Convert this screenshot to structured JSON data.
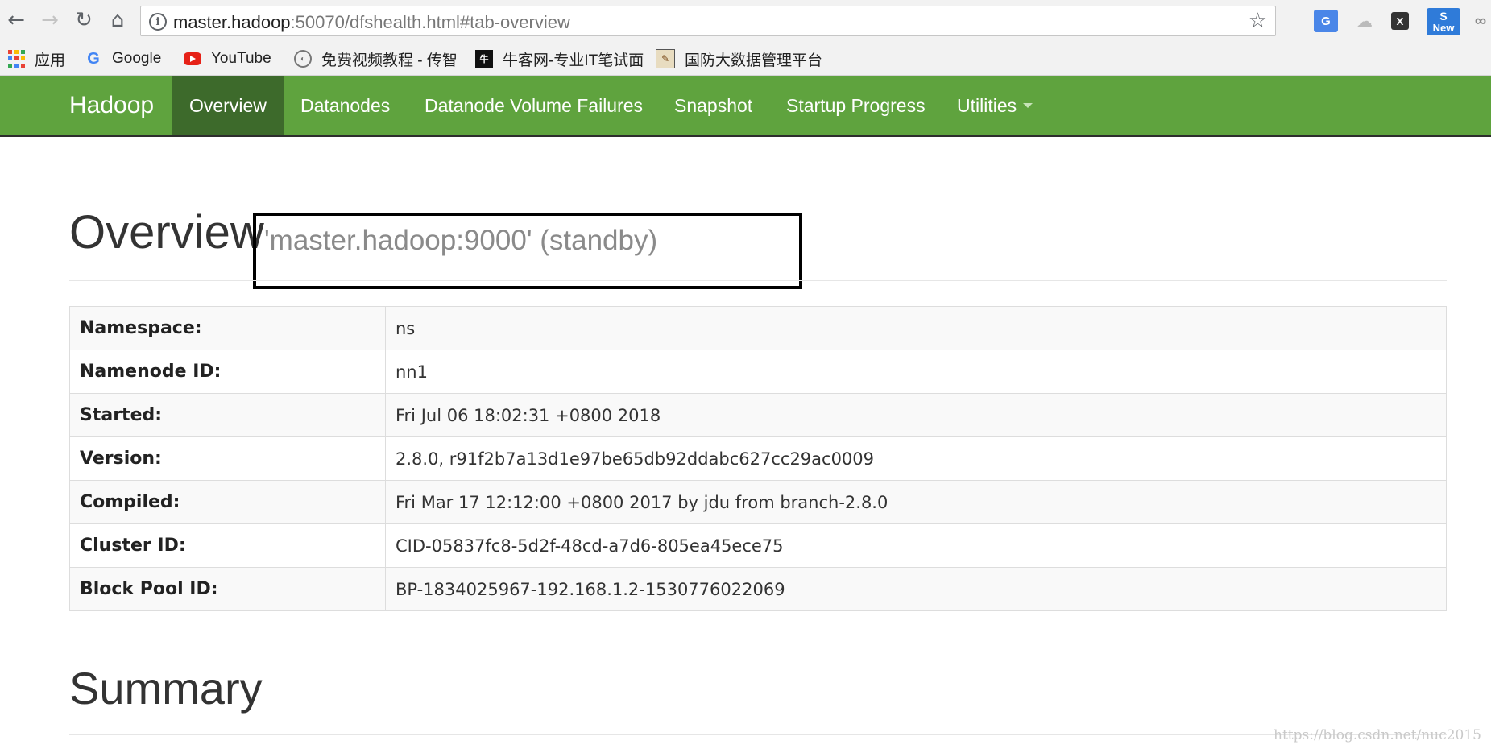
{
  "browser": {
    "url_host": "master.hadoop",
    "url_rest": ":50070/dfshealth.html#tab-overview",
    "extensions": {
      "new_badge": "New"
    },
    "bookmarks": [
      {
        "label": "应用",
        "icon": "apps-grid-icon"
      },
      {
        "label": "Google",
        "icon": "google-icon"
      },
      {
        "label": "YouTube",
        "icon": "youtube-icon"
      },
      {
        "label": "免费视频教程 - 传智",
        "icon": "globe-icon"
      },
      {
        "label": "牛客网-专业IT笔试面",
        "icon": "nowcoder-icon"
      },
      {
        "label": "国防大数据管理平台",
        "icon": "bookmark-image-icon"
      }
    ]
  },
  "navbar": {
    "brand": "Hadoop",
    "items": [
      {
        "label": "Overview",
        "active": true
      },
      {
        "label": "Datanodes"
      },
      {
        "label": "Datanode Volume Failures"
      },
      {
        "label": "Snapshot"
      },
      {
        "label": "Startup Progress"
      },
      {
        "label": "Utilities"
      }
    ],
    "colors": {
      "bar": "#5fa33e",
      "active": "#3d6a2b"
    }
  },
  "overview": {
    "title": "Overview",
    "subtitle": "'master.hadoop:9000' (standby)",
    "rows": [
      {
        "key": "Namespace:",
        "value": "ns"
      },
      {
        "key": "Namenode ID:",
        "value": "nn1"
      },
      {
        "key": "Started:",
        "value": "Fri Jul 06 18:02:31 +0800 2018"
      },
      {
        "key": "Version:",
        "value": "2.8.0, r91f2b7a13d1e97be65db92ddabc627cc29ac0009"
      },
      {
        "key": "Compiled:",
        "value": "Fri Mar 17 12:12:00 +0800 2017 by jdu from branch-2.8.0"
      },
      {
        "key": "Cluster ID:",
        "value": "CID-05837fc8-5d2f-48cd-a7d6-805ea45ece75"
      },
      {
        "key": "Block Pool ID:",
        "value": "BP-1834025967-192.168.1.2-1530776022069"
      }
    ]
  },
  "summary": {
    "title": "Summary"
  },
  "watermark": "https://blog.csdn.net/nuc2015"
}
